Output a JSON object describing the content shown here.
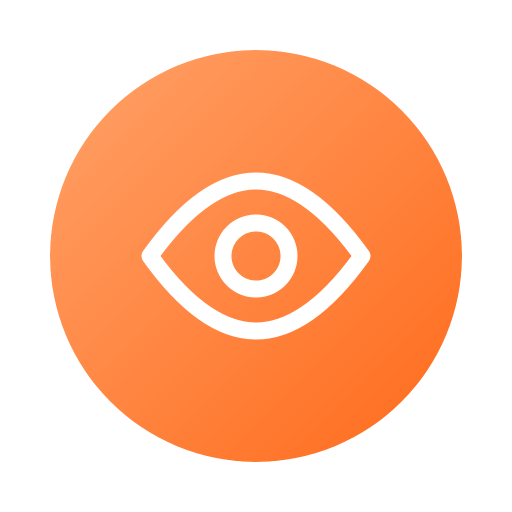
{
  "icon": {
    "name": "eye-icon",
    "kind": "app-icon",
    "shape": "circle",
    "glyph": "eye",
    "glyph_color": "#ffffff"
  },
  "colors": {
    "gradient_top_left": "#ffa269",
    "gradient_bottom_right": "#ff6a1a",
    "background": "#ffffff"
  }
}
